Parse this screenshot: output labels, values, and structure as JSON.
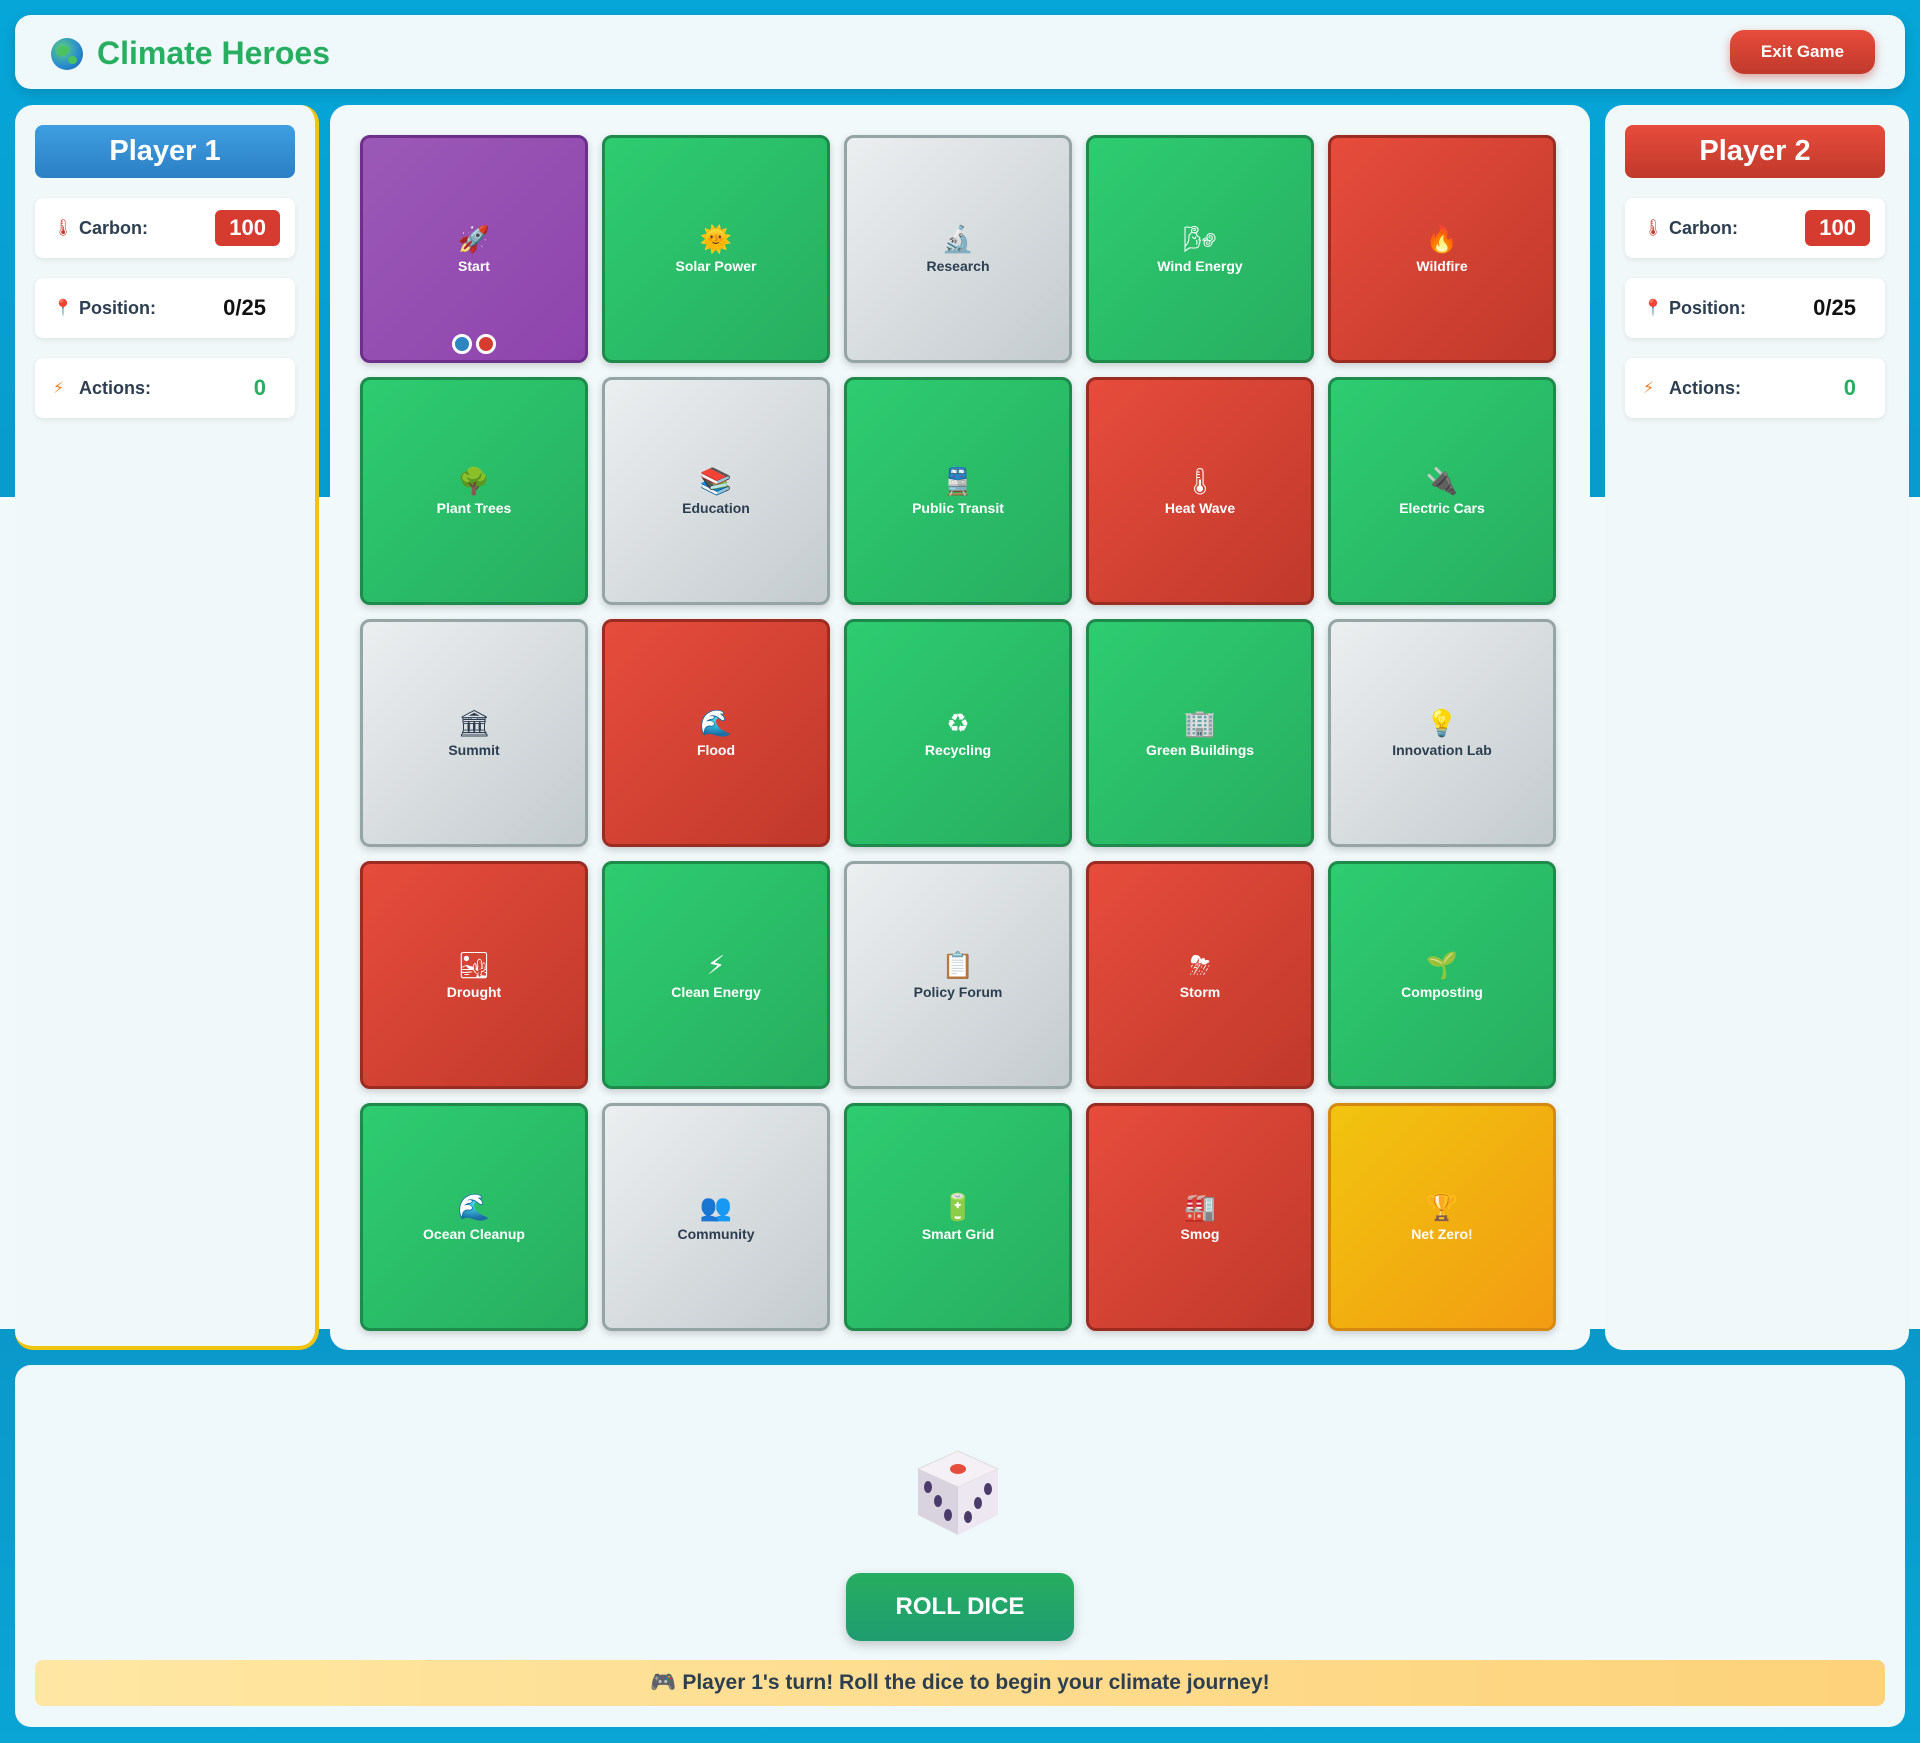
{
  "app": {
    "title": "Climate Heroes",
    "exit_label": "Exit Game"
  },
  "players": [
    {
      "name": "Player 1",
      "carbon_label": "Carbon:",
      "carbon": "100",
      "position_label": "Position:",
      "position": "0/25",
      "actions_label": "Actions:",
      "actions": "0"
    },
    {
      "name": "Player 2",
      "carbon_label": "Carbon:",
      "carbon": "100",
      "position_label": "Position:",
      "position": "0/25",
      "actions_label": "Actions:",
      "actions": "0"
    }
  ],
  "icons": {
    "carbon": "thermometer-icon",
    "position": "pin-icon",
    "actions": "lightning-icon"
  },
  "board": [
    {
      "label": "Start",
      "type": "purple",
      "icon": "🚀"
    },
    {
      "label": "Solar Power",
      "type": "green",
      "icon": "🌞"
    },
    {
      "label": "Research",
      "type": "gray",
      "icon": "🔬"
    },
    {
      "label": "Wind Energy",
      "type": "green",
      "icon": "🌬"
    },
    {
      "label": "Wildfire",
      "type": "red",
      "icon": "🔥"
    },
    {
      "label": "Plant Trees",
      "type": "green",
      "icon": "🌳"
    },
    {
      "label": "Education",
      "type": "gray",
      "icon": "📚"
    },
    {
      "label": "Public Transit",
      "type": "green",
      "icon": "🚆"
    },
    {
      "label": "Heat Wave",
      "type": "red",
      "icon": "🌡"
    },
    {
      "label": "Electric Cars",
      "type": "green",
      "icon": "🔌"
    },
    {
      "label": "Summit",
      "type": "gray",
      "icon": "🏛"
    },
    {
      "label": "Flood",
      "type": "red",
      "icon": "🌊"
    },
    {
      "label": "Recycling",
      "type": "green",
      "icon": "♻"
    },
    {
      "label": "Green Buildings",
      "type": "green",
      "icon": "🏢"
    },
    {
      "label": "Innovation Lab",
      "type": "gray",
      "icon": "💡"
    },
    {
      "label": "Drought",
      "type": "red",
      "icon": "🏜"
    },
    {
      "label": "Clean Energy",
      "type": "green",
      "icon": "⚡"
    },
    {
      "label": "Policy Forum",
      "type": "gray",
      "icon": "📋"
    },
    {
      "label": "Storm",
      "type": "red",
      "icon": "⛈"
    },
    {
      "label": "Composting",
      "type": "green",
      "icon": "🌱"
    },
    {
      "label": "Ocean Cleanup",
      "type": "green",
      "icon": "🌊"
    },
    {
      "label": "Community",
      "type": "gray",
      "icon": "👥"
    },
    {
      "label": "Smart Grid",
      "type": "green",
      "icon": "🔋"
    },
    {
      "label": "Smog",
      "type": "red",
      "icon": "🏭"
    },
    {
      "label": "Net Zero!",
      "type": "gold",
      "icon": "🏆"
    }
  ],
  "roll_label": "ROLL DICE",
  "message": "🎮 Player 1's turn! Roll the dice to begin your climate journey!",
  "colors": {
    "green": "#27ae60",
    "red": "#c0392b",
    "blue": "#2c7fc4",
    "gold": "#f1c40f",
    "purple": "#8e44ad"
  }
}
